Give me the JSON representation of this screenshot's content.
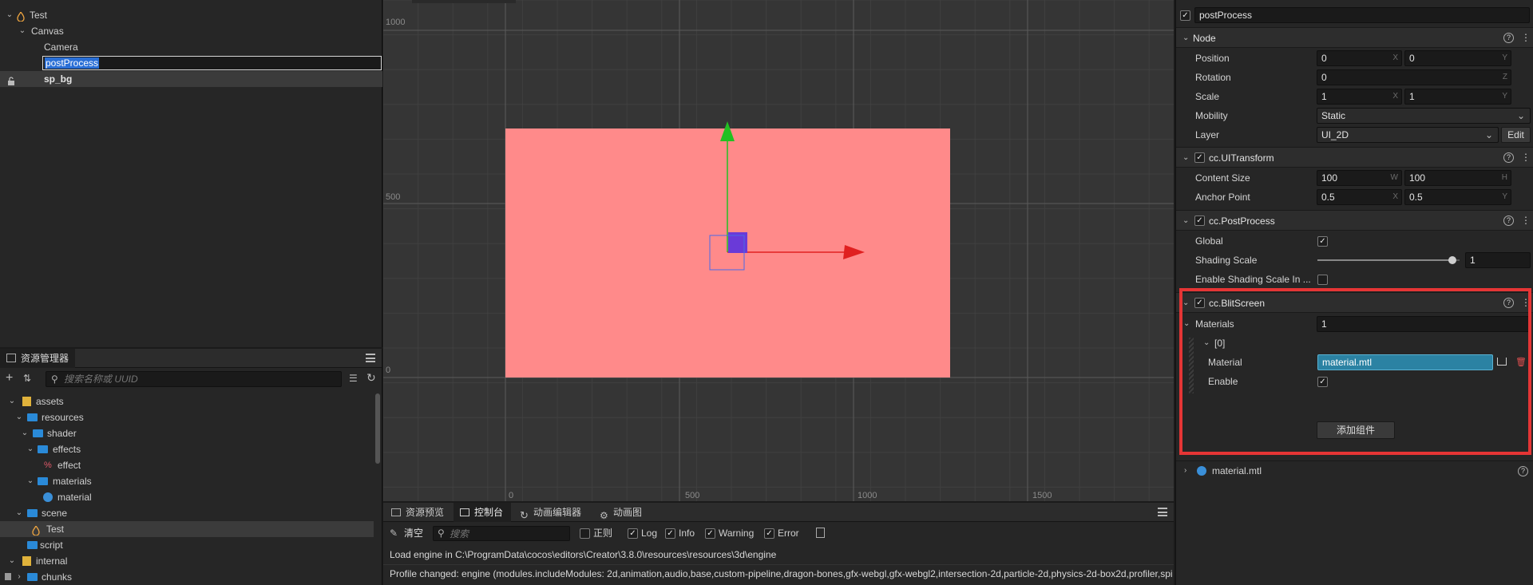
{
  "hierarchy": {
    "items": [
      {
        "label": "Test"
      },
      {
        "label": "Canvas"
      },
      {
        "label": "Camera"
      },
      {
        "label": "postProcess"
      },
      {
        "label": "sp_bg"
      }
    ]
  },
  "assets_panel": {
    "title": "资源管理器",
    "search_placeholder": "搜索名称或 UUID",
    "items": [
      {
        "label": "assets"
      },
      {
        "label": "resources"
      },
      {
        "label": "shader"
      },
      {
        "label": "effects"
      },
      {
        "label": "effect"
      },
      {
        "label": "materials"
      },
      {
        "label": "material"
      },
      {
        "label": "scene"
      },
      {
        "label": "Test"
      },
      {
        "label": "script"
      },
      {
        "label": "internal"
      },
      {
        "label": "chunks"
      }
    ]
  },
  "scene": {
    "y_labels": [
      "1000",
      "500",
      "0"
    ],
    "x_labels": [
      "0",
      "500",
      "1000",
      "1500"
    ]
  },
  "console": {
    "tabs": [
      {
        "label": "资源预览"
      },
      {
        "label": "控制台"
      },
      {
        "label": "动画编辑器"
      },
      {
        "label": "动画图"
      }
    ],
    "clear_label": "清空",
    "search_placeholder": "搜索",
    "regex_label": "正则",
    "filters": [
      {
        "label": "Log",
        "checked": true
      },
      {
        "label": "Info",
        "checked": true
      },
      {
        "label": "Warning",
        "checked": true
      },
      {
        "label": "Error",
        "checked": true
      }
    ],
    "lines": [
      "Load engine in C:\\ProgramData\\cocos\\editors\\Creator\\3.8.0\\resources\\resources\\3d\\engine",
      "Profile changed: engine (modules.includeModules: 2d,animation,audio,base,custom-pipeline,dragon-bones,gfx-webgl,gfx-webgl2,intersection-2d,particle-2d,physics-2d-box2d,profiler,spi"
    ]
  },
  "inspector": {
    "node_name": "postProcess",
    "node_section": {
      "title": "Node",
      "position": {
        "label": "Position",
        "x": "0",
        "y": "0"
      },
      "rotation": {
        "label": "Rotation",
        "z": "0"
      },
      "scale": {
        "label": "Scale",
        "x": "1",
        "y": "1"
      },
      "mobility": {
        "label": "Mobility",
        "value": "Static"
      },
      "layer": {
        "label": "Layer",
        "value": "UI_2D",
        "edit": "Edit"
      }
    },
    "ui_transform": {
      "title": "cc.UITransform",
      "content_size": {
        "label": "Content Size",
        "w": "100",
        "h": "100"
      },
      "anchor_point": {
        "label": "Anchor Point",
        "x": "0.5",
        "y": "0.5"
      }
    },
    "post_process": {
      "title": "cc.PostProcess",
      "global_label": "Global",
      "shading_label": "Shading Scale",
      "shading_value": "1",
      "shading_fraction": 0.95,
      "enable_shading_label": "Enable Shading Scale In ..."
    },
    "blit_screen": {
      "title": "cc.BlitScreen",
      "materials_label": "Materials",
      "materials_count": "1",
      "index_label": "[0]",
      "material_label": "Material",
      "material_value": "material.mtl",
      "enable_label": "Enable"
    },
    "add_component": "添加组件",
    "asset_row": "material.mtl",
    "highlight_color": "#e53535"
  },
  "axis_units": {
    "x": "X",
    "y": "Y",
    "z": "Z",
    "w": "W",
    "h": "H"
  }
}
